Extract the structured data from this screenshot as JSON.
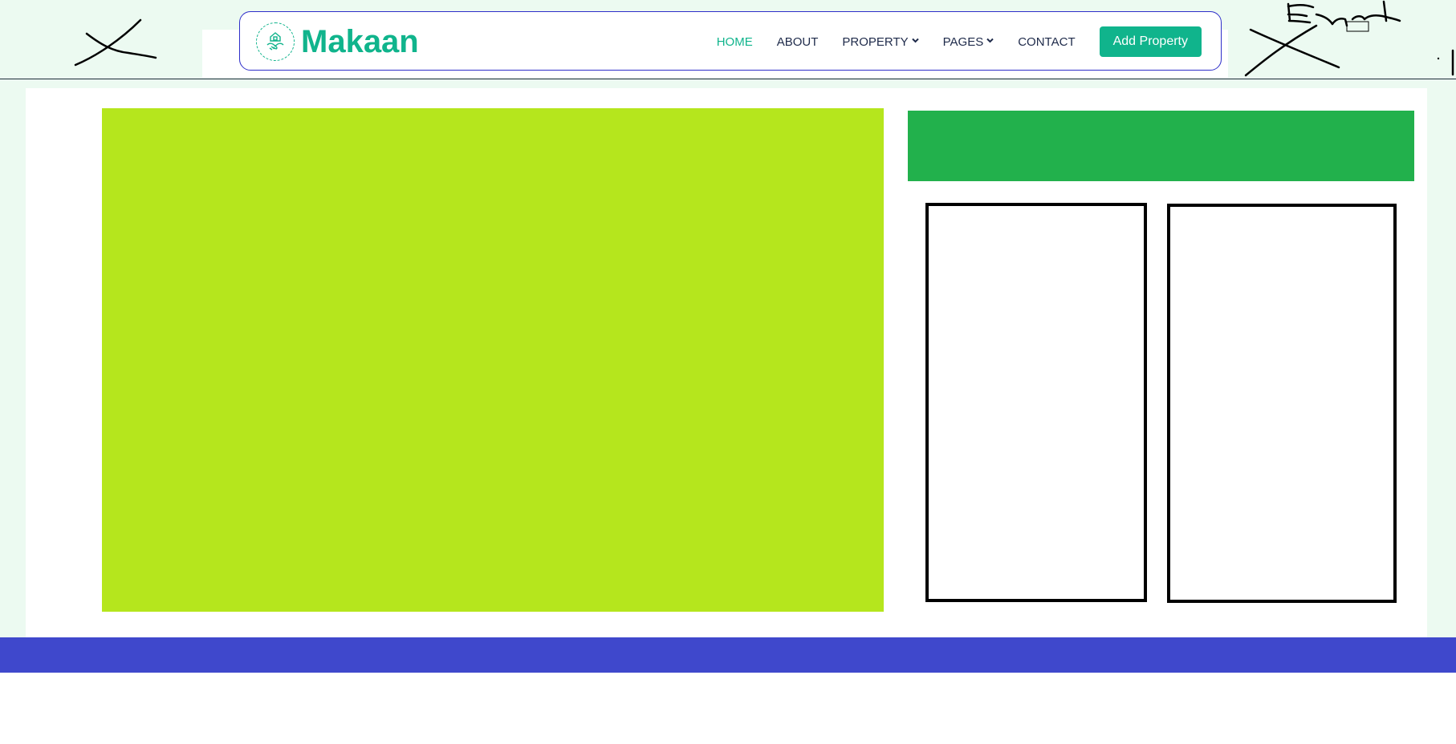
{
  "brand": {
    "name": "Makaan",
    "icon": "handshake-house-icon",
    "color": "#10b48c"
  },
  "nav": {
    "items": [
      {
        "label": "HOME",
        "active": true,
        "dropdown": false
      },
      {
        "label": "ABOUT",
        "active": false,
        "dropdown": false
      },
      {
        "label": "PROPERTY",
        "active": false,
        "dropdown": true
      },
      {
        "label": "PAGES",
        "active": false,
        "dropdown": true
      },
      {
        "label": "CONTACT",
        "active": false,
        "dropdown": false
      }
    ],
    "cta_label": "Add Property"
  },
  "colors": {
    "accent": "#10b48c",
    "nav_text": "#1e2a4a",
    "page_background": "#ecfaf1",
    "navbar_border": "#2e2ec9",
    "hero_block": "#b5e61d",
    "banner": "#22b14c",
    "footer": "#3f48cc",
    "box_border": "#000000"
  }
}
